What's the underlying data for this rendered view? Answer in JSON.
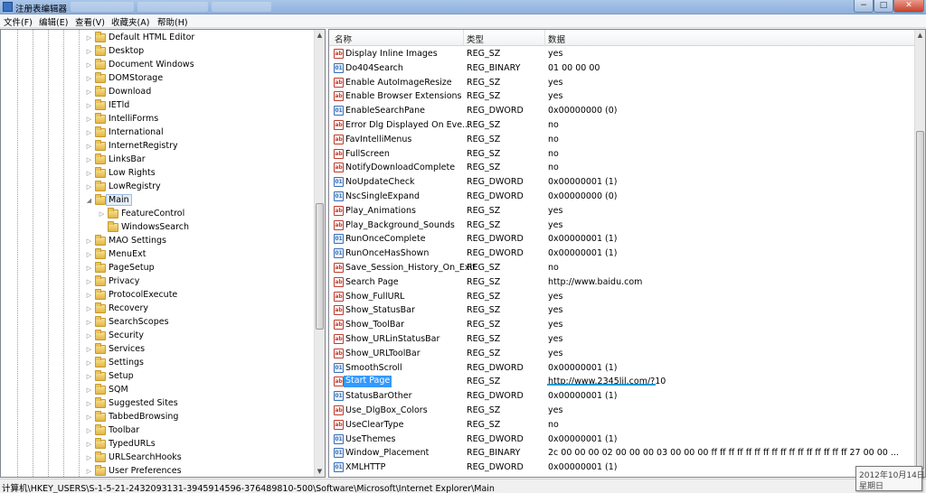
{
  "window": {
    "title": "注册表编辑器",
    "controls": {
      "minimize": "−",
      "maximize": "□",
      "close": "✕"
    }
  },
  "menubar": [
    {
      "label": "文件(F)"
    },
    {
      "label": "编辑(E)"
    },
    {
      "label": "查看(V)"
    },
    {
      "label": "收藏夹(A)"
    },
    {
      "label": "帮助(H)"
    }
  ],
  "tree": {
    "items": [
      {
        "label": "Default HTML Editor",
        "level": 0
      },
      {
        "label": "Desktop",
        "level": 0
      },
      {
        "label": "Document Windows",
        "level": 0
      },
      {
        "label": "DOMStorage",
        "level": 0
      },
      {
        "label": "Download",
        "level": 0
      },
      {
        "label": "IETld",
        "level": 0
      },
      {
        "label": "IntelliForms",
        "level": 0
      },
      {
        "label": "International",
        "level": 0
      },
      {
        "label": "InternetRegistry",
        "level": 0
      },
      {
        "label": "LinksBar",
        "level": 0
      },
      {
        "label": "Low Rights",
        "level": 0
      },
      {
        "label": "LowRegistry",
        "level": 0
      },
      {
        "label": "Main",
        "level": 0,
        "expanded": true,
        "selected": true
      },
      {
        "label": "FeatureControl",
        "level": 1
      },
      {
        "label": "WindowsSearch",
        "level": 1,
        "leaf": true
      },
      {
        "label": "MAO Settings",
        "level": 0
      },
      {
        "label": "MenuExt",
        "level": 0
      },
      {
        "label": "PageSetup",
        "level": 0
      },
      {
        "label": "Privacy",
        "level": 0
      },
      {
        "label": "ProtocolExecute",
        "level": 0
      },
      {
        "label": "Recovery",
        "level": 0
      },
      {
        "label": "SearchScopes",
        "level": 0
      },
      {
        "label": "Security",
        "level": 0
      },
      {
        "label": "Services",
        "level": 0
      },
      {
        "label": "Settings",
        "level": 0
      },
      {
        "label": "Setup",
        "level": 0
      },
      {
        "label": "SQM",
        "level": 0
      },
      {
        "label": "Suggested Sites",
        "level": 0
      },
      {
        "label": "TabbedBrowsing",
        "level": 0
      },
      {
        "label": "Toolbar",
        "level": 0
      },
      {
        "label": "TypedURLs",
        "level": 0
      },
      {
        "label": "URLSearchHooks",
        "level": 0
      },
      {
        "label": "User Preferences",
        "level": 0
      }
    ]
  },
  "list": {
    "columns": {
      "name": "名称",
      "type": "类型",
      "data": "数据"
    },
    "rows": [
      {
        "name": "Display Inline Images",
        "type": "REG_SZ",
        "data": "yes",
        "icon": "string-value-icon"
      },
      {
        "name": "Do404Search",
        "type": "REG_BINARY",
        "data": "01 00 00 00",
        "icon": "binary-value-icon"
      },
      {
        "name": "Enable AutoImageResize",
        "type": "REG_SZ",
        "data": "yes",
        "icon": "string-value-icon"
      },
      {
        "name": "Enable Browser Extensions",
        "type": "REG_SZ",
        "data": "yes",
        "icon": "string-value-icon"
      },
      {
        "name": "EnableSearchPane",
        "type": "REG_DWORD",
        "data": "0x00000000 (0)",
        "icon": "binary-value-icon"
      },
      {
        "name": "Error Dlg Displayed On Eve...",
        "type": "REG_SZ",
        "data": "no",
        "icon": "string-value-icon"
      },
      {
        "name": "FavIntelliMenus",
        "type": "REG_SZ",
        "data": "no",
        "icon": "string-value-icon"
      },
      {
        "name": "FullScreen",
        "type": "REG_SZ",
        "data": "no",
        "icon": "string-value-icon"
      },
      {
        "name": "NotifyDownloadComplete",
        "type": "REG_SZ",
        "data": "no",
        "icon": "string-value-icon"
      },
      {
        "name": "NoUpdateCheck",
        "type": "REG_DWORD",
        "data": "0x00000001 (1)",
        "icon": "binary-value-icon"
      },
      {
        "name": "NscSingleExpand",
        "type": "REG_DWORD",
        "data": "0x00000000 (0)",
        "icon": "binary-value-icon"
      },
      {
        "name": "Play_Animations",
        "type": "REG_SZ",
        "data": "yes",
        "icon": "string-value-icon"
      },
      {
        "name": "Play_Background_Sounds",
        "type": "REG_SZ",
        "data": "yes",
        "icon": "string-value-icon"
      },
      {
        "name": "RunOnceComplete",
        "type": "REG_DWORD",
        "data": "0x00000001 (1)",
        "icon": "binary-value-icon"
      },
      {
        "name": "RunOnceHasShown",
        "type": "REG_DWORD",
        "data": "0x00000001 (1)",
        "icon": "binary-value-icon"
      },
      {
        "name": "Save_Session_History_On_Exit",
        "type": "REG_SZ",
        "data": "no",
        "icon": "string-value-icon"
      },
      {
        "name": "Search Page",
        "type": "REG_SZ",
        "data": "http://www.baidu.com",
        "icon": "string-value-icon"
      },
      {
        "name": "Show_FullURL",
        "type": "REG_SZ",
        "data": "yes",
        "icon": "string-value-icon"
      },
      {
        "name": "Show_StatusBar",
        "type": "REG_SZ",
        "data": "yes",
        "icon": "string-value-icon"
      },
      {
        "name": "Show_ToolBar",
        "type": "REG_SZ",
        "data": "yes",
        "icon": "string-value-icon"
      },
      {
        "name": "Show_URLinStatusBar",
        "type": "REG_SZ",
        "data": "yes",
        "icon": "string-value-icon"
      },
      {
        "name": "Show_URLToolBar",
        "type": "REG_SZ",
        "data": "yes",
        "icon": "string-value-icon"
      },
      {
        "name": "SmoothScroll",
        "type": "REG_DWORD",
        "data": "0x00000001 (1)",
        "icon": "binary-value-icon"
      },
      {
        "name": "Start Page",
        "type": "REG_SZ",
        "data": "http://www.2345lil.com/?10",
        "icon": "string-value-icon",
        "selected": true
      },
      {
        "name": "StatusBarOther",
        "type": "REG_DWORD",
        "data": "0x00000001 (1)",
        "icon": "binary-value-icon"
      },
      {
        "name": "Use_DlgBox_Colors",
        "type": "REG_SZ",
        "data": "yes",
        "icon": "string-value-icon"
      },
      {
        "name": "UseClearType",
        "type": "REG_SZ",
        "data": "no",
        "icon": "string-value-icon"
      },
      {
        "name": "UseThemes",
        "type": "REG_DWORD",
        "data": "0x00000001 (1)",
        "icon": "binary-value-icon"
      },
      {
        "name": "Window_Placement",
        "type": "REG_BINARY",
        "data": "2c 00 00 00 02 00 00 00 03 00 00 00 ff ff ff ff ff ff ff ff ff ff ff ff ff ff ff ff 27 00 00 ...",
        "icon": "binary-value-icon"
      },
      {
        "name": "XMLHTTP",
        "type": "REG_DWORD",
        "data": "0x00000001 (1)",
        "icon": "binary-value-icon"
      }
    ]
  },
  "statusbar": {
    "path": "计算机\\HKEY_USERS\\S-1-5-21-2432093131-3945914596-376489810-500\\Software\\Microsoft\\Internet Explorer\\Main"
  },
  "clock_tooltip": {
    "date": "2012年10月14日",
    "weekday": "星期日"
  },
  "colors": {
    "selection_blue": "#3399ff",
    "annotation_underline": "#1a9ad6"
  }
}
